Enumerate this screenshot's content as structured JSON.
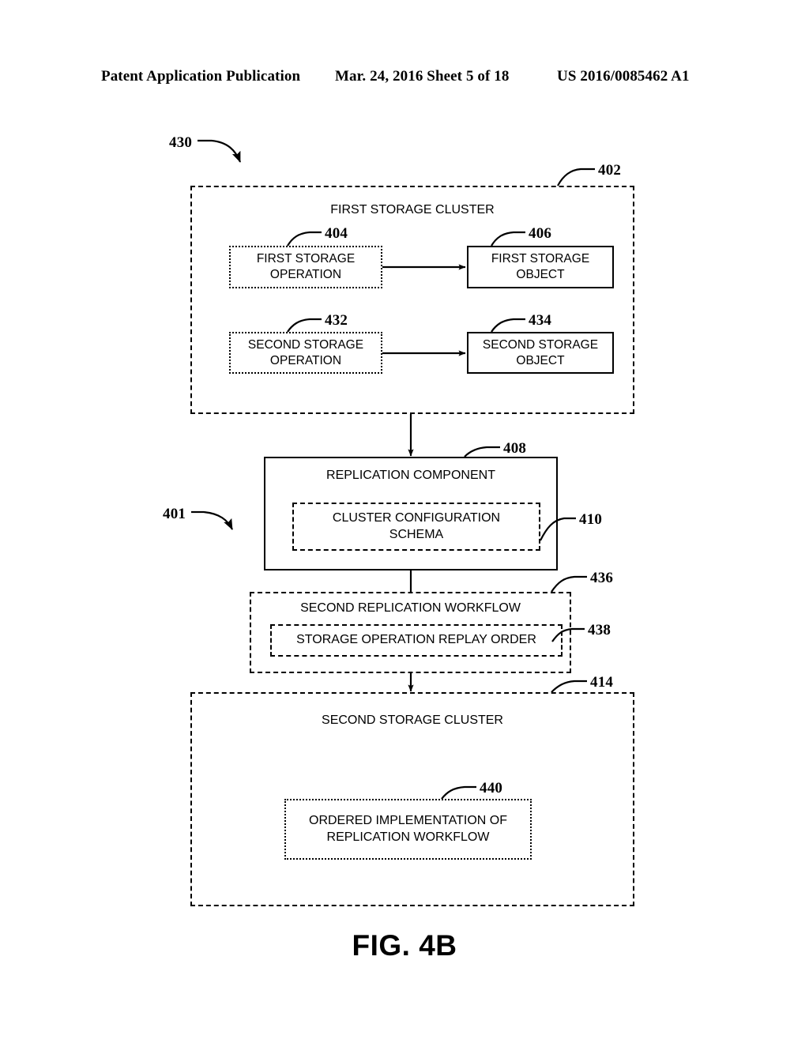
{
  "header": {
    "left": "Patent Application Publication",
    "center": "Mar. 24, 2016  Sheet 5 of 18",
    "right": "US 2016/0085462 A1"
  },
  "figure": {
    "caption": "FIG. 4B",
    "system_ref": "401",
    "method_ref": "430"
  },
  "diagram": {
    "first_cluster": {
      "ref": "402",
      "label": "FIRST STORAGE CLUSTER",
      "rows": [
        {
          "operation": {
            "ref": "404",
            "label_line1": "FIRST STORAGE",
            "label_line2": "OPERATION"
          },
          "object": {
            "ref": "406",
            "label_line1": "FIRST STORAGE",
            "label_line2": "OBJECT"
          }
        },
        {
          "operation": {
            "ref": "432",
            "label_line1": "SECOND STORAGE",
            "label_line2": "OPERATION"
          },
          "object": {
            "ref": "434",
            "label_line1": "SECOND STORAGE",
            "label_line2": "OBJECT"
          }
        }
      ]
    },
    "replication_component": {
      "ref": "408",
      "label": "REPLICATION COMPONENT",
      "schema": {
        "ref": "410",
        "label_line1": "CLUSTER CONFIGURATION",
        "label_line2": "SCHEMA"
      }
    },
    "second_workflow": {
      "ref": "436",
      "label": "SECOND REPLICATION WORKFLOW",
      "replay_order": {
        "ref": "438",
        "label": "STORAGE OPERATION REPLAY ORDER"
      }
    },
    "second_cluster": {
      "ref": "414",
      "label": "SECOND STORAGE CLUSTER",
      "ordered_implementation": {
        "ref": "440",
        "label_line1": "ORDERED IMPLEMENTATION OF",
        "label_line2": "REPLICATION WORKFLOW"
      }
    }
  }
}
